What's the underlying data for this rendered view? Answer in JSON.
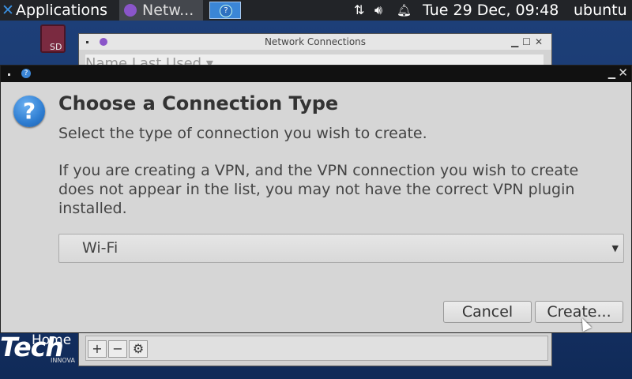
{
  "panel": {
    "applications_label": "Applications",
    "task_network_label": "Netw...",
    "clock": "Tue 29 Dec, 09:48",
    "user": "ubuntu"
  },
  "desktop": {
    "sd_label": "SD",
    "home_label": "Home",
    "logo_text": "Tech",
    "logo_sub": "INNOVA"
  },
  "network_window": {
    "title": "Network Connections",
    "header_text": "Name                                       Last Used ▾",
    "add_label": "+",
    "remove_label": "−",
    "settings_label": "⚙"
  },
  "dialog": {
    "heading": "Choose a Connection Type",
    "subtext": "Select the type of connection you wish to create.",
    "vpn_note": "If you are creating a VPN, and the VPN connection you wish to create does not appear in the list, you may not have the correct VPN plugin installed.",
    "selected_type": "Wi-Fi",
    "cancel_label": "Cancel",
    "create_label": "Create..."
  },
  "colors": {
    "accent": "#3b86d6",
    "panel_bg": "#222428",
    "dialog_bg": "#d6d6d6"
  }
}
